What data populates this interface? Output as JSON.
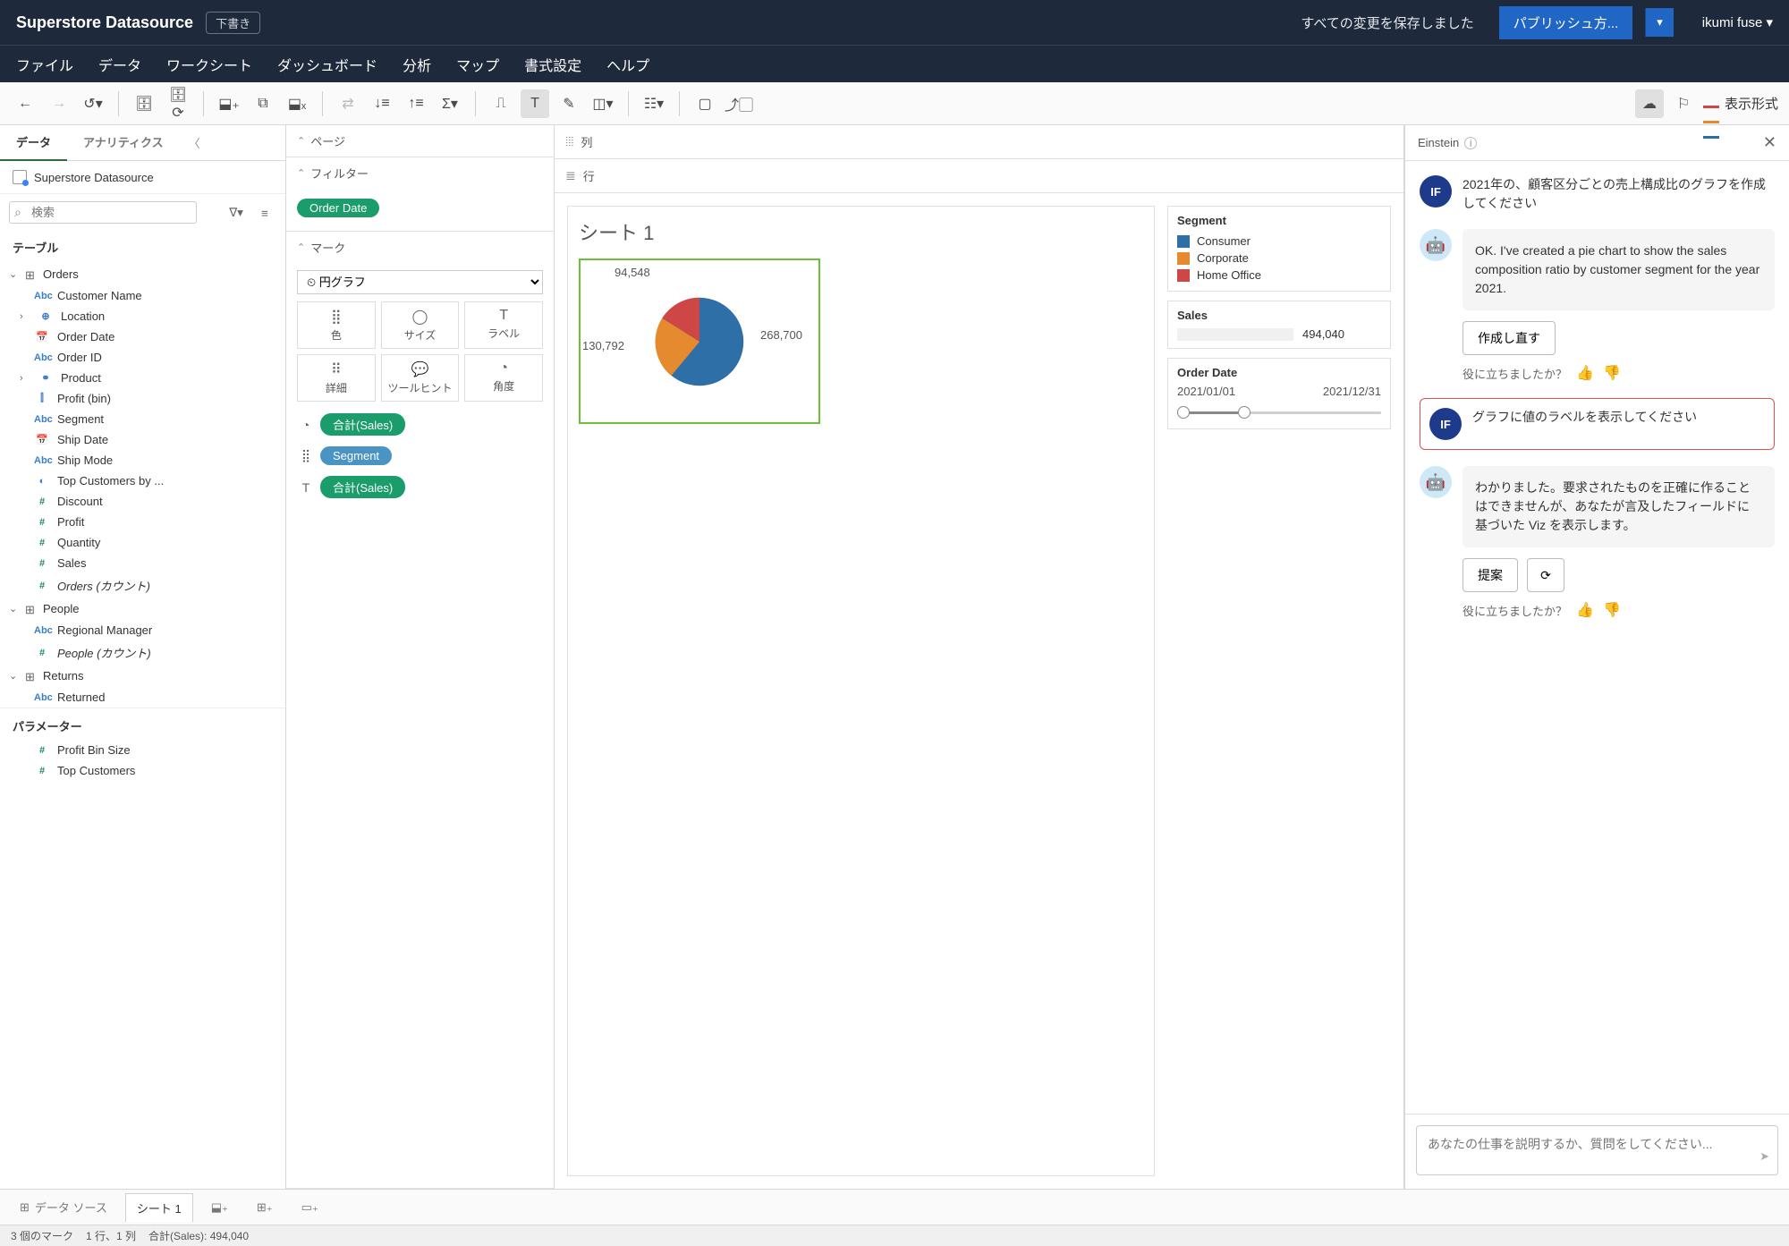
{
  "topbar": {
    "title": "Superstore Datasource",
    "draft": "下書き",
    "saved": "すべての変更を保存しました",
    "publish": "パブリッシュ方...",
    "user": "ikumi fuse ▾"
  },
  "menu": [
    "ファイル",
    "データ",
    "ワークシート",
    "ダッシュボード",
    "分析",
    "マップ",
    "書式設定",
    "ヘルプ"
  ],
  "show_me": "表示形式",
  "datapane": {
    "tabs": [
      "データ",
      "アナリティクス"
    ],
    "ds": "Superstore Datasource",
    "search_ph": "検索",
    "tables_hdr": "テーブル",
    "param_hdr": "パラメーター",
    "orders": "Orders",
    "orders_fields": [
      {
        "icon": "Abc",
        "cls": "fi-abc",
        "label": "Customer Name"
      },
      {
        "icon": "⊕",
        "cls": "fi-geo",
        "label": "Location",
        "chev": true
      },
      {
        "icon": "📅",
        "cls": "fi-date",
        "label": "Order Date"
      },
      {
        "icon": "Abc",
        "cls": "fi-abc",
        "label": "Order ID"
      },
      {
        "icon": "⚭",
        "cls": "fi-geo",
        "label": "Product",
        "chev": true
      },
      {
        "icon": "⫿",
        "cls": "fi-bin",
        "label": "Profit (bin)"
      },
      {
        "icon": "Abc",
        "cls": "fi-abc",
        "label": "Segment"
      },
      {
        "icon": "📅",
        "cls": "fi-date",
        "label": "Ship Date"
      },
      {
        "icon": "Abc",
        "cls": "fi-abc",
        "label": "Ship Mode"
      },
      {
        "icon": "◐",
        "cls": "fi-set",
        "label": "Top Customers by ..."
      },
      {
        "icon": "#",
        "cls": "fi-num",
        "label": "Discount"
      },
      {
        "icon": "#",
        "cls": "fi-num",
        "label": "Profit"
      },
      {
        "icon": "#",
        "cls": "fi-num",
        "label": "Quantity"
      },
      {
        "icon": "#",
        "cls": "fi-num",
        "label": "Sales"
      },
      {
        "icon": "#",
        "cls": "fi-num",
        "label": "Orders (カウント)",
        "italic": true
      }
    ],
    "people": "People",
    "people_fields": [
      {
        "icon": "Abc",
        "cls": "fi-abc",
        "label": "Regional Manager"
      },
      {
        "icon": "#",
        "cls": "fi-num",
        "label": "People (カウント)",
        "italic": true
      }
    ],
    "returns": "Returns",
    "returns_fields": [
      {
        "icon": "Abc",
        "cls": "fi-abc",
        "label": "Returned"
      }
    ],
    "params": [
      {
        "icon": "#",
        "cls": "fi-num",
        "label": "Profit Bin Size"
      },
      {
        "icon": "#",
        "cls": "fi-num",
        "label": "Top Customers"
      }
    ]
  },
  "cards": {
    "pages": "ページ",
    "filters": "フィルター",
    "filter_pill": "Order Date",
    "marks": "マーク",
    "mark_type": "⏲ 円グラフ",
    "mark_cells": [
      {
        "icon": "⣿",
        "label": "色"
      },
      {
        "icon": "◯",
        "label": "サイズ"
      },
      {
        "icon": "T",
        "label": "ラベル"
      },
      {
        "icon": "⠿",
        "label": "詳細"
      },
      {
        "icon": "💬",
        "label": "ツールヒント"
      },
      {
        "icon": "◔",
        "label": "角度"
      }
    ],
    "mark_pills": [
      {
        "ico": "◔",
        "label": "合計(Sales)",
        "cls": "pill"
      },
      {
        "ico": "⣿",
        "label": "Segment",
        "cls": "pill pill-blue"
      },
      {
        "ico": "T",
        "label": "合計(Sales)",
        "cls": "pill"
      }
    ]
  },
  "shelves": {
    "columns": "列",
    "rows": "行"
  },
  "sheet": {
    "title": "シート 1",
    "labels": {
      "top": "94,548",
      "left": "130,792",
      "right": "268,700"
    }
  },
  "legend": {
    "segment_title": "Segment",
    "segments": [
      {
        "color": "#2e6fa7",
        "label": "Consumer"
      },
      {
        "color": "#e58a2e",
        "label": "Corporate"
      },
      {
        "color": "#cf4647",
        "label": "Home Office"
      }
    ],
    "sales_title": "Sales",
    "sales_value": "494,040",
    "orderdate_title": "Order Date",
    "date_from": "2021/01/01",
    "date_to": "2021/12/31"
  },
  "einstein": {
    "title": "Einstein",
    "user_initials": "IF",
    "msg1": "2021年の、顧客区分ごとの売上構成比のグラフを作成してください",
    "bot1": "OK. I've created a pie chart to show the sales composition ratio by customer segment for the year 2021.",
    "regen": "作成し直す",
    "helpful": "役に立ちましたか？",
    "msg2": "グラフに値のラベルを表示してください",
    "bot2": "わかりました。要求されたものを正確に作ることはできませんが、あなたが言及したフィールドに基づいた Viz を表示します。",
    "suggest": "提案",
    "input_ph": "あなたの仕事を説明するか、質問をしてください..."
  },
  "tabs": {
    "datasource": "データ ソース",
    "sheet": "シート 1"
  },
  "status": {
    "marks": "3 個のマーク",
    "rowcol": "1 行、1 列",
    "agg": "合計(Sales): 494,040"
  },
  "chart_data": {
    "type": "pie",
    "title": "シート 1",
    "categories": [
      "Consumer",
      "Corporate",
      "Home Office"
    ],
    "values": [
      268700,
      130792,
      94548
    ],
    "colors": [
      "#2e6fa7",
      "#e58a2e",
      "#cf4647"
    ],
    "total": 494040,
    "filter": {
      "field": "Order Date",
      "from": "2021/01/01",
      "to": "2021/12/31"
    }
  }
}
